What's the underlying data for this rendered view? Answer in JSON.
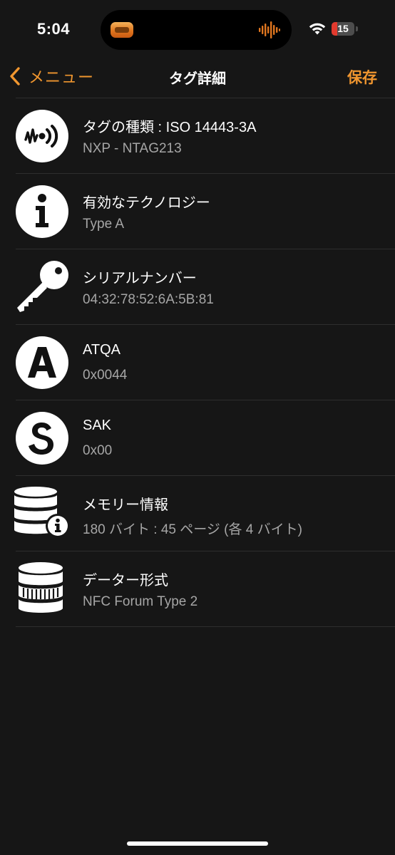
{
  "status_bar": {
    "time": "5:04",
    "battery_level": "15"
  },
  "nav": {
    "back_label": "メニュー",
    "title": "タグ詳細",
    "save_label": "保存",
    "accent_color": "#f0962f"
  },
  "rows": [
    {
      "icon": "nfc-signal-icon",
      "title": "タグの種類 : ISO 14443-3A",
      "value": "NXP - NTAG213"
    },
    {
      "icon": "info-icon",
      "title": "有効なテクノロジー",
      "value": "Type A"
    },
    {
      "icon": "key-icon",
      "title": "シリアルナンバー",
      "value": "04:32:78:52:6A:5B:81"
    },
    {
      "icon": "letter-a-icon",
      "title": "ATQA",
      "value": "0x0044"
    },
    {
      "icon": "letter-s-icon",
      "title": "SAK",
      "value": "0x00"
    },
    {
      "icon": "database-info-icon",
      "title": "メモリー情報",
      "value": "180 バイト : 45 ページ (各 4 バイト)"
    },
    {
      "icon": "database-icon",
      "title": "データー形式",
      "value": "NFC Forum Type 2"
    }
  ]
}
